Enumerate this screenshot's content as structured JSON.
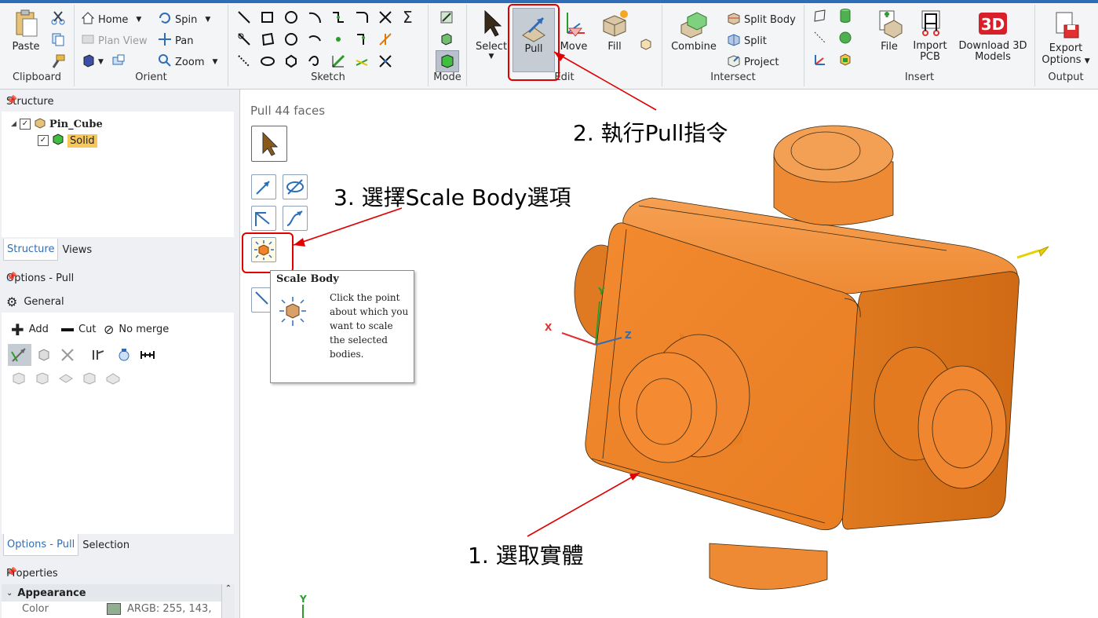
{
  "ribbon": {
    "clipboard": {
      "title": "Clipboard",
      "paste": "Paste"
    },
    "orient": {
      "title": "Orient",
      "home": "Home",
      "plan_view": "Plan View",
      "spin": "Spin",
      "pan": "Pan",
      "zoom": "Zoom"
    },
    "sketch": {
      "title": "Sketch"
    },
    "mode": {
      "title": "Mode"
    },
    "edit": {
      "title": "Edit",
      "select": "Select",
      "pull": "Pull",
      "move": "Move",
      "fill": "Fill"
    },
    "intersect": {
      "title": "Intersect",
      "combine": "Combine",
      "split_body": "Split Body",
      "split": "Split",
      "project": "Project"
    },
    "insert": {
      "title": "Insert",
      "file": "File",
      "import_pcb_1": "Import",
      "import_pcb_2": "PCB",
      "download_1": "Download 3D",
      "download_2": "Models"
    },
    "output": {
      "title": "Output",
      "export_1": "Export",
      "export_2": "Options"
    }
  },
  "structure": {
    "title": "Structure",
    "root": "Pin_Cube",
    "child": "Solid",
    "tabs": [
      "Structure",
      "Views"
    ]
  },
  "options": {
    "title": "Options - Pull",
    "general": "General",
    "add": "Add",
    "cut": "Cut",
    "no_merge": "No merge",
    "tabs": [
      "Options - Pull",
      "Selection"
    ]
  },
  "properties": {
    "title": "Properties",
    "appearance": "Appearance",
    "color_label": "Color",
    "color_value": "ARGB: 255, 143,",
    "color_swatch": "#8faf8f"
  },
  "viewport": {
    "status": "Pull 44 faces",
    "axis_x": "X",
    "axis_y": "Y",
    "axis_z": "Z",
    "axis_y_bottom": "Y"
  },
  "tooltip": {
    "title": "Scale Body",
    "lines": [
      "Click the point",
      "about which you",
      "want to scale",
      "the selected",
      "bodies."
    ]
  },
  "annotations": {
    "step1": "1. 選取實體",
    "step2": "2. 執行Pull指令",
    "step3": "3. 選擇Scale Body選項"
  },
  "colors": {
    "body": "#f0842a",
    "accent": "#2f6db6",
    "highlight": "#e00000"
  }
}
